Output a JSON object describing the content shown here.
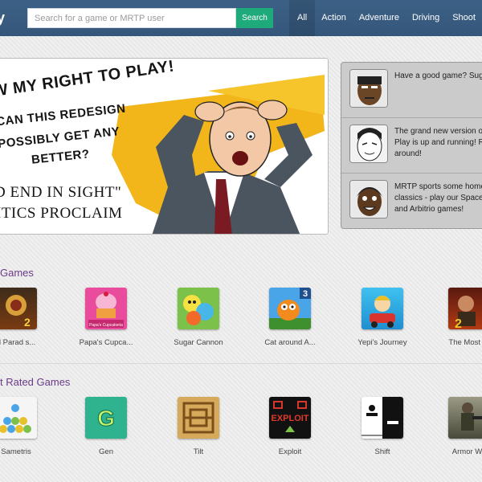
{
  "header": {
    "logo_fragment": "y",
    "search_placeholder": "Search for a game or MRTP user",
    "search_button": "Search",
    "nav": [
      "All",
      "Action",
      "Adventure",
      "Driving",
      "Shoot"
    ]
  },
  "hero": {
    "line1": "W MY RIGHT TO PLAY!",
    "line2": "CAN THIS REDESIGN",
    "line3": "POSSIBLY GET ANY",
    "line4": "BETTER?",
    "line5": "D END IN SIGHT\"",
    "line6": "ITICS PROCLAIM"
  },
  "news": [
    {
      "text": "Have a good game? Sugg"
    },
    {
      "text": "The grand new version o\nPlay is up and running! R\naround!"
    },
    {
      "text": "MRTP sports some home\nclassics - play our Space\nand Arbitrio games!"
    }
  ],
  "sections": [
    {
      "title": "Games",
      "games": [
        {
          "label": "d Parad s..."
        },
        {
          "label": "Papa's Cupca..."
        },
        {
          "label": "Sugar Cannon"
        },
        {
          "label": "Cat around A..."
        },
        {
          "label": "Yepi's Journey"
        },
        {
          "label": "The Most W"
        }
      ]
    },
    {
      "title": "t Rated Games",
      "games": [
        {
          "label": "Sametris"
        },
        {
          "label": "Gen"
        },
        {
          "label": "Tilt"
        },
        {
          "label": "Exploit"
        },
        {
          "label": "Shift"
        },
        {
          "label": "Armor Wa"
        }
      ]
    }
  ],
  "thumb_text": {
    "papa": "Papa's Cupcakeria",
    "cat_num": "3",
    "gen": "G",
    "exploit": "EXPLOIT",
    "mw_num": "2",
    "dp_num": "2"
  },
  "colors": {
    "header": "#375a7f",
    "search_button": "#1faa7b",
    "section_title": "#6a3b8a"
  }
}
